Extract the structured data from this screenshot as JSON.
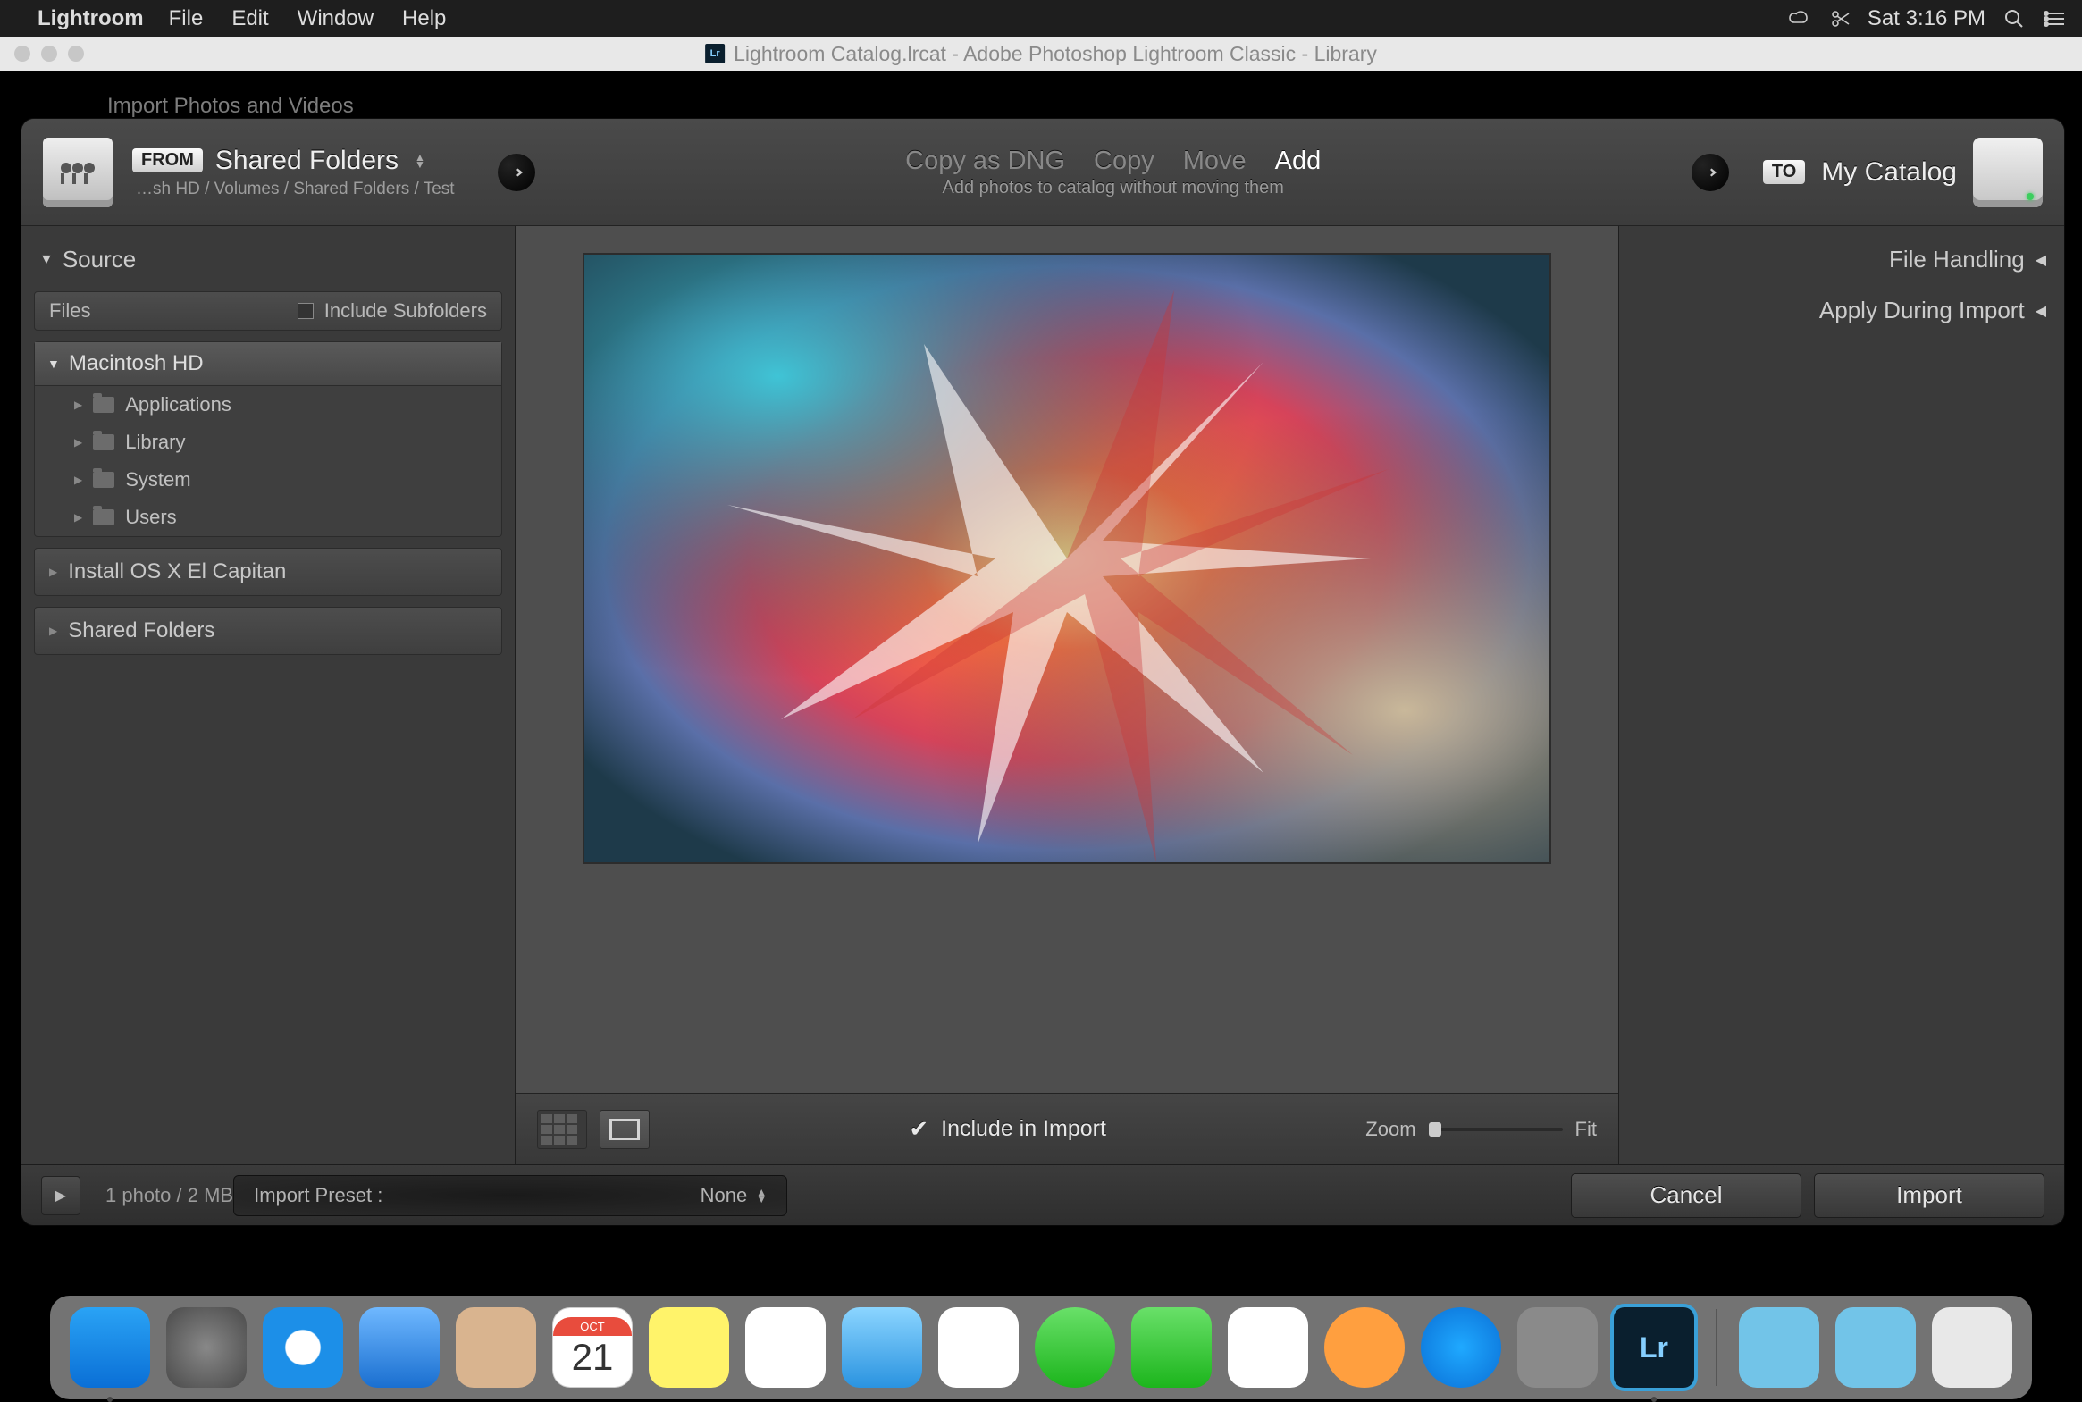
{
  "menubar": {
    "app": "Lightroom",
    "items": [
      "File",
      "Edit",
      "Window",
      "Help"
    ],
    "clock": "Sat 3:16 PM"
  },
  "window": {
    "title": "Lightroom Catalog.lrcat - Adobe Photoshop Lightroom Classic - Library",
    "under": "Import Photos and Videos"
  },
  "import": {
    "from_badge": "FROM",
    "from_title": "Shared Folders",
    "from_path": "…sh HD / Volumes / Shared Folders / Test",
    "modes": {
      "dng": "Copy as DNG",
      "copy": "Copy",
      "move": "Move",
      "add": "Add"
    },
    "mode_sub": "Add photos to catalog without moving them",
    "to_badge": "TO",
    "to_title": "My Catalog"
  },
  "source": {
    "header": "Source",
    "files_label": "Files",
    "include_sub": "Include Subfolders",
    "root": "Macintosh HD",
    "children": [
      "Applications",
      "Library",
      "System",
      "Users"
    ],
    "drives": [
      "Install OS X El Capitan",
      "Shared Folders"
    ]
  },
  "center": {
    "include_label": "Include in Import",
    "zoom_label": "Zoom",
    "fit_label": "Fit"
  },
  "right": {
    "file_handling": "File Handling",
    "apply": "Apply During Import"
  },
  "footer": {
    "status": "1 photo / 2 MB",
    "preset_label": "Import Preset :",
    "preset_value": "None",
    "cancel": "Cancel",
    "import": "Import"
  },
  "dock": {
    "cal_month": "OCT",
    "cal_day": "21",
    "lr": "Lr"
  }
}
